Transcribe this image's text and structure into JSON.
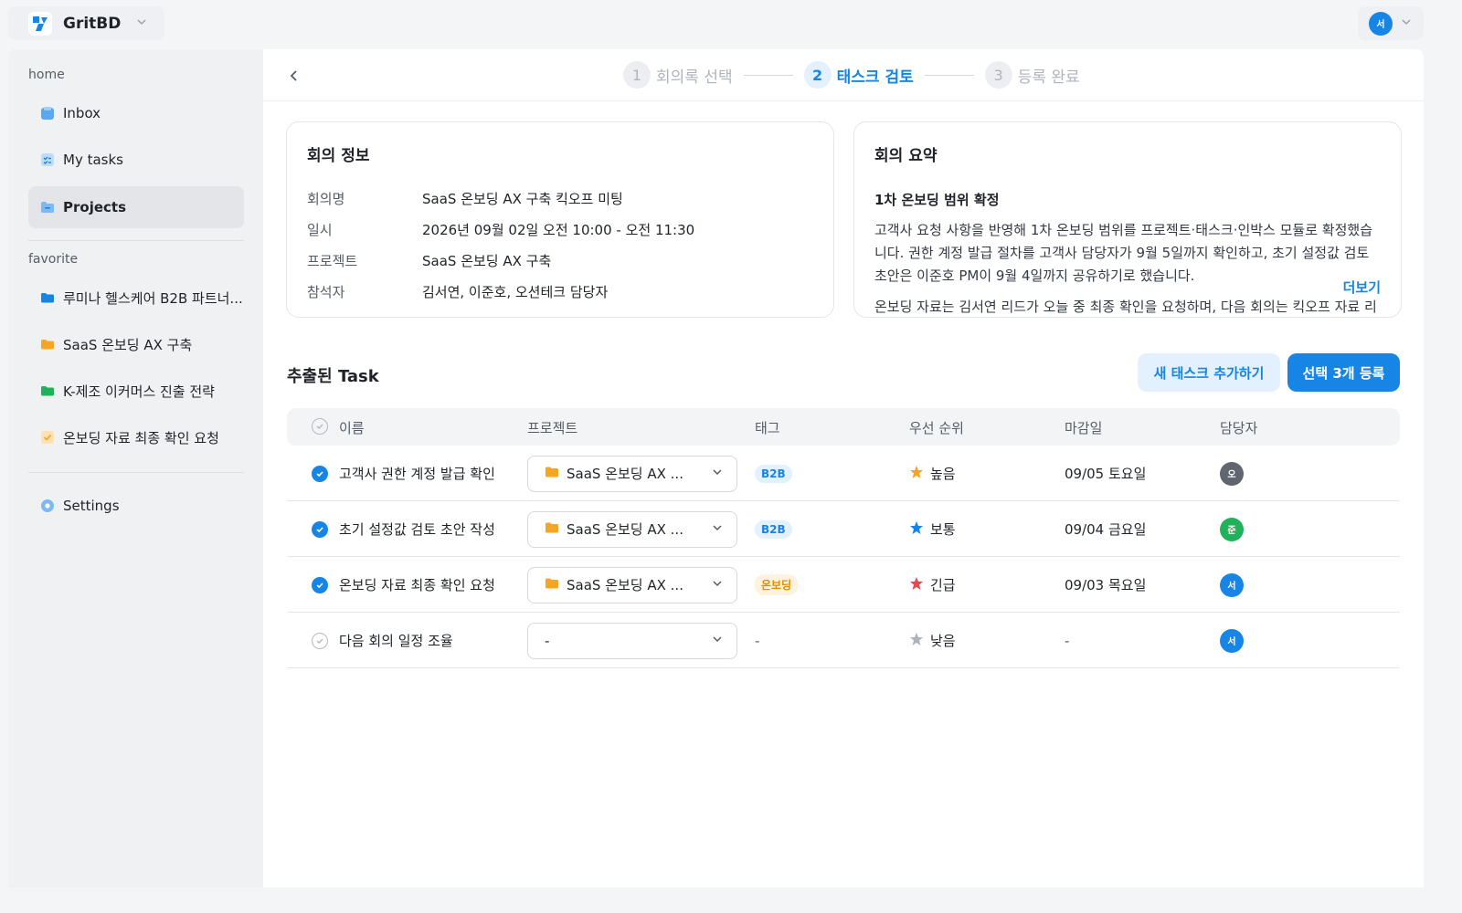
{
  "workspace": {
    "name": "GritBD"
  },
  "user": {
    "avatar_initial": "서",
    "avatar_color": "#1785e6"
  },
  "sidebar": {
    "home_label": "home",
    "favorite_label": "favorite",
    "home_items": [
      {
        "label": "Inbox",
        "icon": "inbox-icon"
      },
      {
        "label": "My tasks",
        "icon": "checklist-icon"
      },
      {
        "label": "Projects",
        "icon": "folder-icon",
        "active": true
      }
    ],
    "favorite_items": [
      {
        "label": "루미나 헬스케어 B2B 파트너...",
        "color": "#1785e6"
      },
      {
        "label": "SaaS 온보딩 AX 구축",
        "color": "#f5a623"
      },
      {
        "label": "K-제조 이커머스 진출 전략",
        "color": "#1fb25a"
      },
      {
        "label": "온보딩 자료 최종 확인 요청",
        "color": "#f5a623",
        "icon": "check-icon"
      }
    ],
    "settings_label": "Settings"
  },
  "stepper": {
    "steps": [
      {
        "num": "1",
        "label": "회의록 선택"
      },
      {
        "num": "2",
        "label": "태스크 검토",
        "active": true
      },
      {
        "num": "3",
        "label": "등록 완료"
      }
    ]
  },
  "meeting_info": {
    "title": "회의 정보",
    "rows": [
      {
        "key": "회의명",
        "value": "SaaS 온보딩 AX 구축 킥오프 미팅"
      },
      {
        "key": "일시",
        "value": "2026년 09월 02일 오전 10:00 - 오전 11:30"
      },
      {
        "key": "프로젝트",
        "value": "SaaS 온보딩 AX 구축"
      },
      {
        "key": "참석자",
        "value": "김서연, 이준호, 오션테크 담당자"
      }
    ]
  },
  "summary": {
    "title": "회의 요약",
    "subtitle": "1차 온보딩 범위 확정",
    "text": "고객사 요청 사항을 반영해 1차 온보딩 범위를 프로젝트·태스크·인박스 모듈로 확정했습니다. 권한 계정 발급 절차를 고객사 담당자가 9월 5일까지 확인하고, 초기 설정값 검토 초안은 이준호 PM이 9월 4일까지 공유하기로 했습니다.",
    "text2": "온보딩 자료는 김서연 리드가 오늘 중 최종 확인을 요청하며, 다음 회의는 킥오프 자료 리",
    "more": "더보기"
  },
  "tasks": {
    "title": "추출된 Task",
    "add_button": "새 태스크 추가하기",
    "register_button": "선택 3개 등록",
    "headers": {
      "name": "이름",
      "project": "프로젝트",
      "tag": "태그",
      "priority": "우선 순위",
      "due": "마감일",
      "assignee": "담당자"
    },
    "rows": [
      {
        "checked": true,
        "name": "고객사 권한 계정 발급 확인",
        "project": "SaaS 온보딩 AX ...",
        "tag": "B2B",
        "tag_style": "blue",
        "priority": "높음",
        "star_color": "#f5a623",
        "due": "09/05 토요일",
        "assignee": "오",
        "assignee_color": "#5f6670"
      },
      {
        "checked": true,
        "name": "초기 설정값 검토 초안 작성",
        "project": "SaaS 온보딩 AX ...",
        "tag": "B2B",
        "tag_style": "blue",
        "priority": "보통",
        "star_color": "#1785e6",
        "due": "09/04 금요일",
        "assignee": "준",
        "assignee_color": "#1fb25a"
      },
      {
        "checked": true,
        "name": "온보딩 자료 최종 확인 요청",
        "project": "SaaS 온보딩 AX ...",
        "tag": "온보딩",
        "tag_style": "orange",
        "priority": "긴급",
        "star_color": "#e8474f",
        "due": "09/03 목요일",
        "assignee": "서",
        "assignee_color": "#1785e6"
      },
      {
        "checked": false,
        "name": "다음 회의 일정 조율",
        "project": "-",
        "tag": "-",
        "tag_style": "none",
        "priority": "낮음",
        "star_color": "#aeb4bd",
        "due": "-",
        "assignee": "서",
        "assignee_color": "#1785e6"
      }
    ]
  }
}
